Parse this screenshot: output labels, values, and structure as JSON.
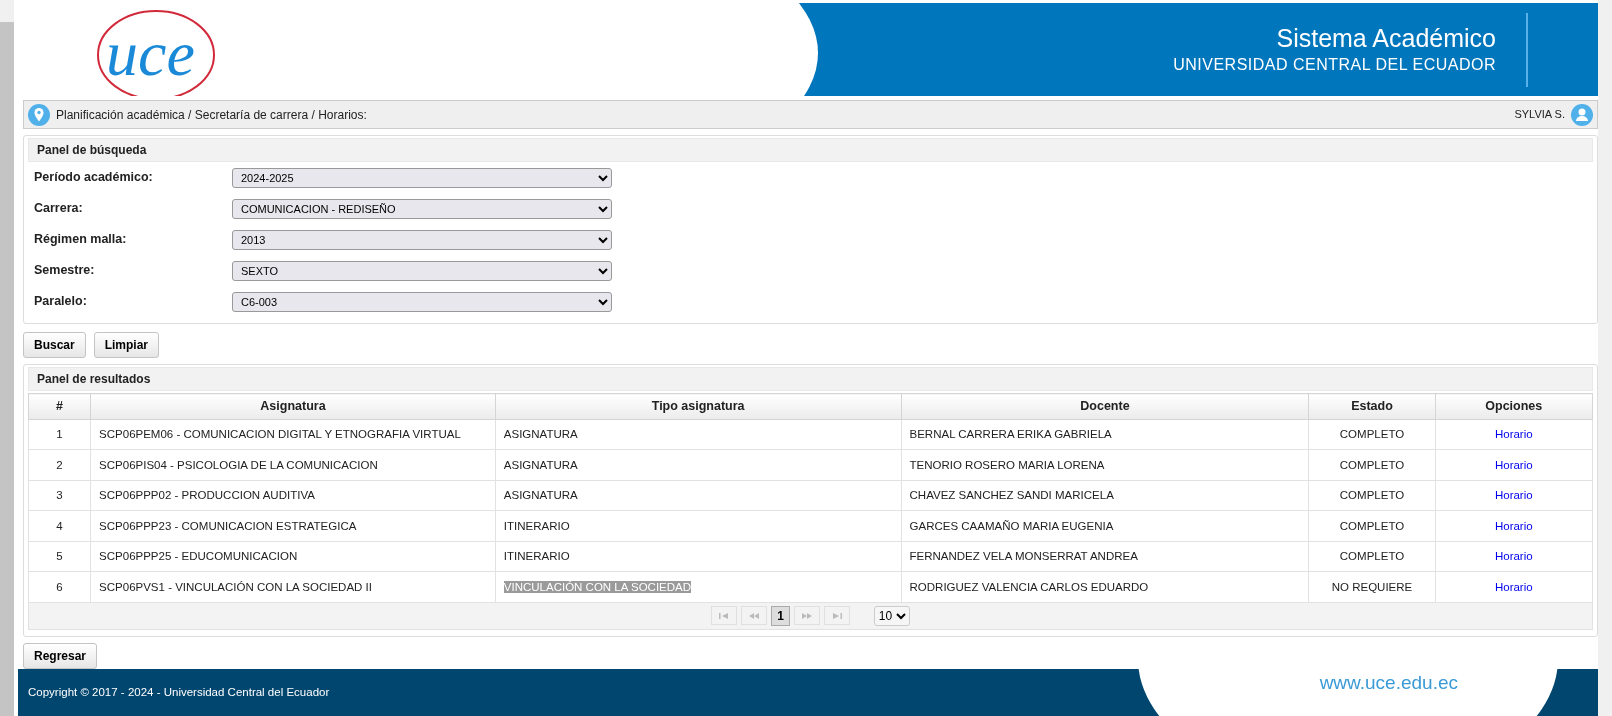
{
  "header": {
    "logo_text": "uce",
    "title": "Sistema Académico",
    "subtitle": "UNIVERSIDAD CENTRAL DEL ECUADOR"
  },
  "breadcrumb": {
    "path": "Planificación académica / Secretaría de carrera / Horarios:",
    "user": "SYLVIA S."
  },
  "search_panel": {
    "title": "Panel de búsqueda",
    "fields": [
      {
        "label": "Período académico:",
        "value": "2024-2025"
      },
      {
        "label": "Carrera:",
        "value": "COMUNICACION - REDISEÑO"
      },
      {
        "label": "Régimen malla:",
        "value": "2013"
      },
      {
        "label": "Semestre:",
        "value": "SEXTO"
      },
      {
        "label": "Paralelo:",
        "value": "C6-003"
      }
    ]
  },
  "search_buttons": [
    "Buscar",
    "Limpiar"
  ],
  "results_panel": {
    "title": "Panel de resultados",
    "table": {
      "columns": [
        "#",
        "Asignatura",
        "Tipo asignatura",
        "Docente",
        "Estado",
        "Opciones"
      ],
      "rows": [
        {
          "number": "1",
          "subject": "SCP06PEM06 - COMUNICACION DIGITAL Y ETNOGRAFIA VIRTUAL",
          "type": "ASIGNATURA",
          "type_highlighted": false,
          "teacher": "BERNAL CARRERA ERIKA GABRIELA",
          "status": "COMPLETO",
          "option": "Horario"
        },
        {
          "number": "2",
          "subject": "SCP06PIS04 - PSICOLOGIA DE LA COMUNICACION",
          "type": "ASIGNATURA",
          "type_highlighted": false,
          "teacher": "TENORIO ROSERO MARIA LORENA",
          "status": "COMPLETO",
          "option": "Horario"
        },
        {
          "number": "3",
          "subject": "SCP06PPP02 - PRODUCCION AUDITIVA",
          "type": "ASIGNATURA",
          "type_highlighted": false,
          "teacher": "CHAVEZ SANCHEZ SANDI MARICELA",
          "status": "COMPLETO",
          "option": "Horario"
        },
        {
          "number": "4",
          "subject": "SCP06PPP23 - COMUNICACION ESTRATEGICA",
          "type": "ITINERARIO",
          "type_highlighted": false,
          "teacher": "GARCES CAAMAÑO MARIA EUGENIA",
          "status": "COMPLETO",
          "option": "Horario"
        },
        {
          "number": "5",
          "subject": "SCP06PPP25 - EDUCOMUNICACION",
          "type": "ITINERARIO",
          "type_highlighted": false,
          "teacher": "FERNANDEZ VELA MONSERRAT ANDREA",
          "status": "COMPLETO",
          "option": "Horario"
        },
        {
          "number": "6",
          "subject": "SCP06PVS1 - VINCULACIÓN CON LA SOCIEDAD II",
          "type": "VINCULACIÓN CON LA SOCIEDAD",
          "type_highlighted": true,
          "teacher": "RODRIGUEZ VALENCIA CARLOS EDUARDO",
          "status": "NO REQUIERE",
          "option": "Horario"
        }
      ]
    },
    "paginator": {
      "pages": [
        {
          "label": "1",
          "selected": true
        }
      ],
      "rows_per_page": "10"
    }
  },
  "back_button": "Regresar",
  "footer": {
    "copyright": "Copyright © 2017 - 2024 - Universidad Central del Ecuador",
    "website": "www.uce.edu.ec"
  }
}
